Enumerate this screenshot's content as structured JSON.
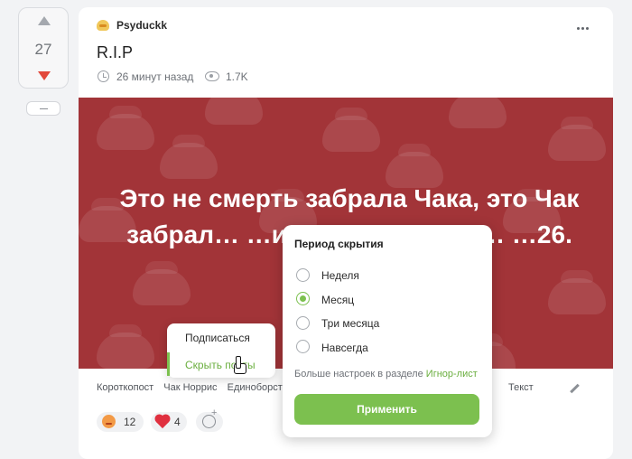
{
  "vote": {
    "count": "27"
  },
  "post": {
    "author": "Psyduckk",
    "title": "R.I.P",
    "time": "26 минут назад",
    "views": "1.7K",
    "image_text": "Это не смерть забрала Чака, это Чак забрал… …ился с миром ве… …26."
  },
  "tags": {
    "items": [
      "Короткопост",
      "Чак Норрис",
      "Единоборст"
    ],
    "partial": "ы",
    "last": "Текст"
  },
  "reactions": [
    {
      "icon": "angry-face-emoji-icon",
      "count": "12"
    },
    {
      "icon": "heart-icon",
      "count": "4"
    },
    {
      "icon": "add-reaction-icon"
    }
  ],
  "context_menu": {
    "subscribe": "Подписаться",
    "hide_posts": "Скрыть посты"
  },
  "hide_popup": {
    "title": "Период скрытия",
    "options": [
      "Неделя",
      "Месяц",
      "Три месяца",
      "Навсегда"
    ],
    "selected": "Месяц",
    "hint": "Больше настроек в разделе ",
    "hint_link": "Игнор-лист",
    "apply": "Применить"
  },
  "colors": {
    "accent_green": "#7cc04f",
    "image_bg": "#a23438",
    "downvote": "#e2483b"
  }
}
